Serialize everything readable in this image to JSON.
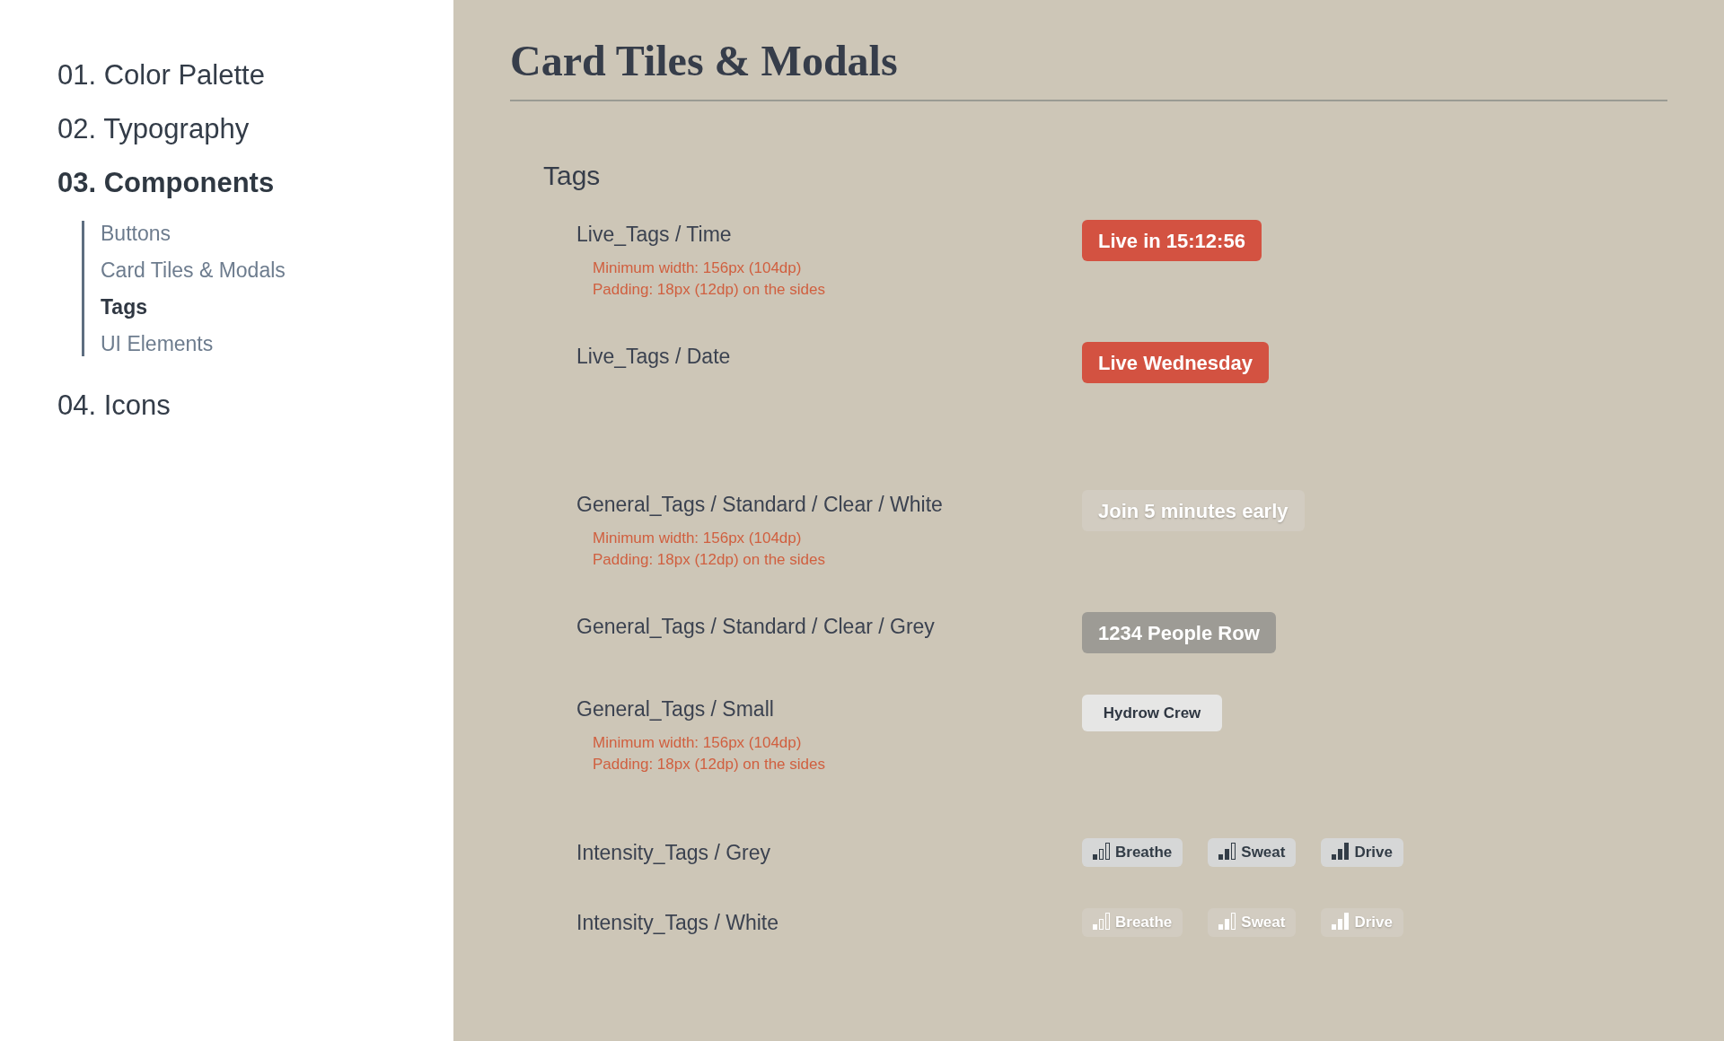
{
  "sidebar": {
    "items": [
      {
        "label": "01. Color Palette",
        "selected": false
      },
      {
        "label": "02. Typography",
        "selected": false
      },
      {
        "label": "03. Components",
        "selected": true,
        "children": [
          {
            "label": "Buttons",
            "selected": false
          },
          {
            "label": "Card Tiles & Modals",
            "selected": false
          },
          {
            "label": "Tags",
            "selected": true
          },
          {
            "label": "UI Elements",
            "selected": false
          }
        ]
      },
      {
        "label": "04. Icons",
        "selected": false
      }
    ]
  },
  "page_title": "Card Tiles & Modals",
  "section": {
    "title": "Tags",
    "groups": [
      {
        "rows": [
          {
            "label": "Live_Tags / Time",
            "notes": [
              "Minimum width: 156px (104dp)",
              "Padding: 18px (12dp) on the sides"
            ],
            "kind": "live",
            "tags": [
              {
                "text": "Live in 15:12:56"
              }
            ]
          },
          {
            "label": "Live_Tags / Date",
            "kind": "live",
            "tags": [
              {
                "text": "Live Wednesday"
              }
            ]
          }
        ]
      },
      {
        "rows": [
          {
            "label": "General_Tags / Standard / Clear / White",
            "notes": [
              "Minimum width: 156px (104dp)",
              "Padding: 18px (12dp) on the sides"
            ],
            "kind": "clear_white",
            "tags": [
              {
                "text": "Join 5 minutes early"
              }
            ]
          },
          {
            "label": "General_Tags / Standard / Clear / Grey",
            "kind": "clear_grey",
            "tags": [
              {
                "text": "1234 People Row"
              }
            ]
          },
          {
            "label": "General_Tags / Small",
            "notes": [
              "Minimum width: 156px (104dp)",
              "Padding: 18px (12dp) on the sides"
            ],
            "kind": "small",
            "tags": [
              {
                "text": "Hydrow Crew"
              }
            ]
          }
        ]
      },
      {
        "rows": [
          {
            "label": "Intensity_Tags / Grey",
            "kind": "intensity_grey",
            "tags": [
              {
                "text": "Breathe",
                "level": 0.33
              },
              {
                "text": "Sweat",
                "level": 0.67
              },
              {
                "text": "Drive",
                "level": 1
              }
            ]
          },
          {
            "label": "Intensity_Tags / White",
            "kind": "intensity_white",
            "tags": [
              {
                "text": "Breathe",
                "level": 0.33
              },
              {
                "text": "Sweat",
                "level": 0.67
              },
              {
                "text": "Drive",
                "level": 1
              }
            ]
          }
        ]
      }
    ]
  }
}
